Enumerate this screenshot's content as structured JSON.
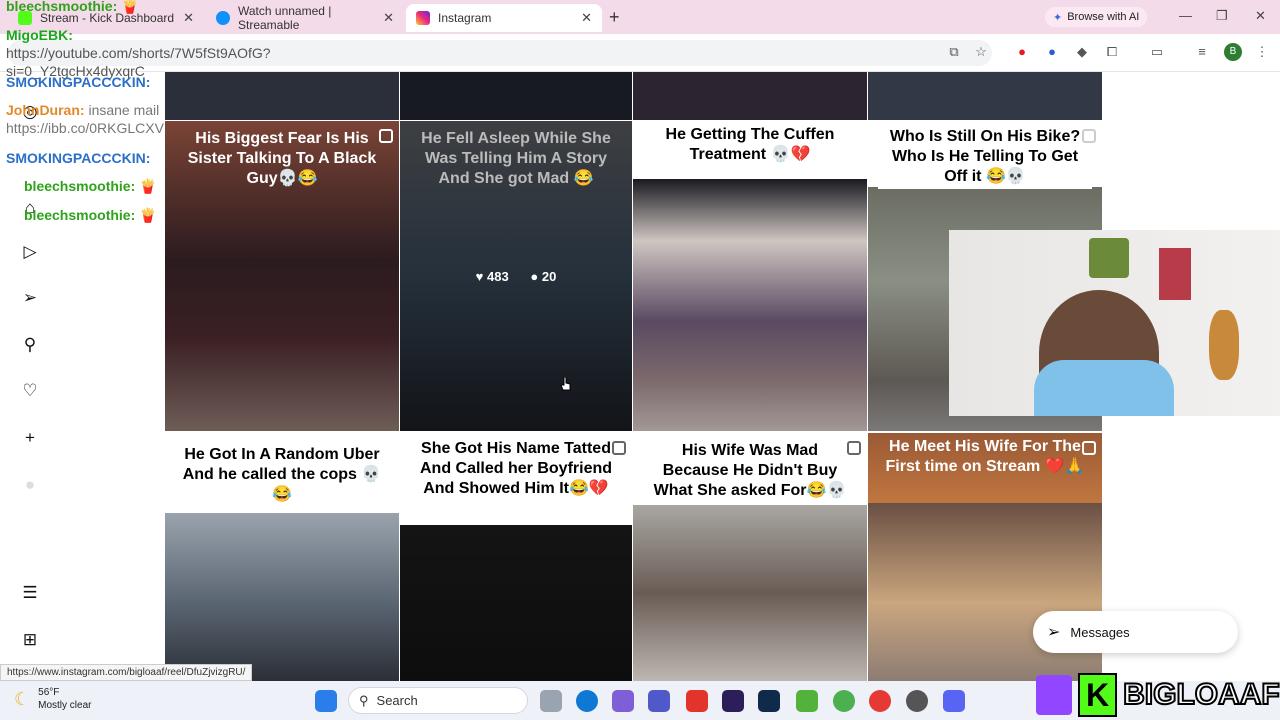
{
  "browser": {
    "tabs": [
      {
        "label": "Stream - Kick Dashboard",
        "color": "#53fc18"
      },
      {
        "label": "Watch unnamed | Streamable",
        "color": "#0f90fa"
      },
      {
        "label": "Instagram",
        "color": "#d62976"
      }
    ],
    "new_tab": "+",
    "browse_ai": "Browse with AI",
    "minimize": "—",
    "restore": "❐",
    "close": "✕",
    "profile_initial": "B"
  },
  "stream_chat": [
    {
      "user": "bleechsmoothie:",
      "text": "🍟",
      "color": "#2fa31b"
    },
    {
      "user": "MigoEBK:",
      "text": "https://youtube.com/shorts/7W5fSt9AOfG?si=0_Y2tgcHx4dyxqrC",
      "color": "#19a81a"
    },
    {
      "user": "SMOKINGPACCCKIN:",
      "text": "",
      "color": "#2b6fc9"
    },
    {
      "user": "JohnDuran:",
      "text": "insane mail https://ibb.co/0RKGLCXV",
      "color": "#e2892b"
    },
    {
      "user": "SMOKINGPACCCKIN:",
      "text": "",
      "color": "#2b6fc9"
    },
    {
      "user": "bleechsmoothie:",
      "text": "🍟",
      "color": "#2fa31b"
    },
    {
      "user": "bleechsmoothie:",
      "text": "🍟",
      "color": "#2fa31b"
    }
  ],
  "instagram": {
    "tiles": [
      {
        "caption": "His Biggest Fear Is His Sister Talking To A Black Guy💀😂"
      },
      {
        "caption": "He Fell Asleep While She Was Telling Him A Story And She got Mad 😂",
        "likes": "483",
        "comments": "20"
      },
      {
        "caption": "He Getting The Cuffen Treatment 💀💔"
      },
      {
        "caption": "Who Is Still On His Bike? Who Is He Telling To Get Off it 😂💀"
      },
      {
        "caption": "He Got In A Random Uber And he called the cops 💀 😂"
      },
      {
        "caption": "She Got His Name Tatted And Called her Boyfriend And Showed Him It😂💔"
      },
      {
        "caption": "His Wife Was Mad Because He Didn't Buy What She asked For😂💀"
      },
      {
        "caption": "He Meet His Wife For The First time on Stream ❤️🙏"
      }
    ],
    "messages_label": "Messages"
  },
  "status_url": "https://www.instagram.com/bigloaaf/reel/DfuZjvizgRU/",
  "taskbar": {
    "weather_temp": "56°F",
    "weather_desc": "Mostly clear",
    "search_placeholder": "Search"
  },
  "overlay": {
    "brand_letter": "K",
    "brand_name": "BIGLOAAF"
  }
}
